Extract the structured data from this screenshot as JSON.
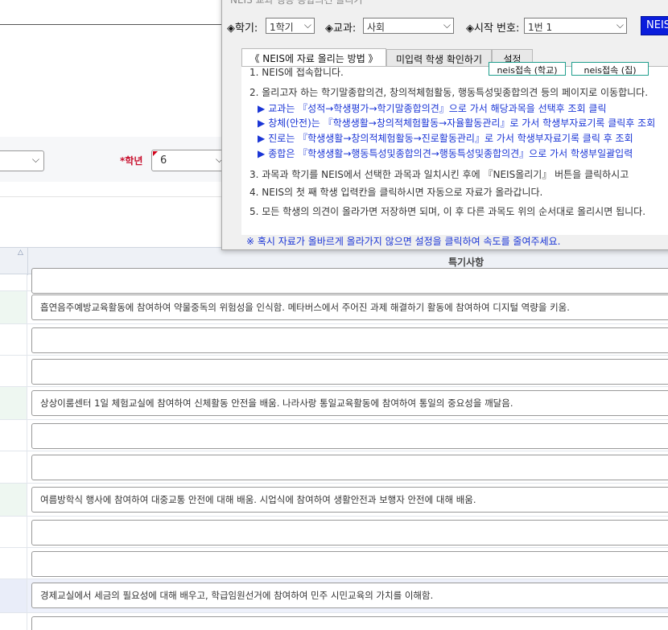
{
  "popup": {
    "title": "NEIS 교과 행동 종합의견 올리기",
    "semester_label": "◈학기:",
    "semester_value": "1학기",
    "subject_label": "◈교과:",
    "subject_value": "사회",
    "start_label": "◈시작 번호:",
    "start_value": "1번 1",
    "neis_button": "NEIS",
    "tabs": [
      {
        "label": "《 NEIS에 자료 올리는 방법 》"
      },
      {
        "label": "미입력 학생 확인하기"
      },
      {
        "label": "설정"
      }
    ],
    "step1": "1. NEIS에 접속합니다.",
    "connect_school": "neis접속 (학교)",
    "connect_home": "neis접속 (집)",
    "step2": "2. 올리고자 하는 학기말종합의견, 창의적체험활동, 행동특성및종합의견 등의 페이지로 이동합니다.",
    "sub_items": [
      "교과는 『성적→학생평가→학기말종합의견』으로 가서 해당과목을 선택후 조회 클릭",
      "창체(안전)는 『학생생활→창의적체험활동→자율활동관리』로 가서 학생부자료기록 클릭후 조회",
      "진로는 『학생생활→창의적체험활동→진로활동관리』로 가서 학생부자료기록 클릭 후 조회",
      "종합은 『학생생활→행동특성및종합의견→행동특성및종합의견』으로 가서 학생부일괄입력"
    ],
    "step3": "3. 과목과 학기를 NEIS에서 선택한 과목과 일치시킨 후에 『NEIS올리기』 버튼을 클릭하시고",
    "step4": "4. NEIS의 첫 째 학생 입력칸을 클릭하시면 자동으로 자료가 올라갑니다.",
    "step5": "5. 모든 학생의 의견이 올라가면 저장하면 되며, 이 후 다른 과목도 위의 순서대로 올리시면 됩니다.",
    "notice": "※ 혹시 자료가 올바르게 올라가지 않으면 설정을 클릭하여 속도를 줄여주세요."
  },
  "filters": {
    "grade_star": "*",
    "grade_label": "학년",
    "grade_value": "6"
  },
  "table": {
    "header": "특기사항",
    "rows": [
      {
        "text": ""
      },
      {
        "text": "흡연음주예방교육활동에 참여하여 약물중독의 위험성을 인식함. 메타버스에서 주어진 과제 해결하기 활동에 참여하여 디지털 역량을 키움."
      },
      {
        "text": ""
      },
      {
        "text": ""
      },
      {
        "text": "상상이룸센터 1일 체험교실에 참여하여 신체활동 안전을 배움. 나라사랑 통일교육활동에 참여하여 통일의 중요성을 깨달음."
      },
      {
        "text": ""
      },
      {
        "text": ""
      },
      {
        "text": "여름방학식 행사에 참여하여 대중교통 안전에 대해 배움. 시업식에 참여하여 생활안전과 보행자 안전에 대해 배움."
      },
      {
        "text": ""
      },
      {
        "text": ""
      },
      {
        "text": "경제교실에서 세금의 필요성에 대해 배우고, 학급임원선거에 참여하여 민주 시민교육의 가치를 이해함."
      },
      {
        "text": ""
      }
    ]
  },
  "colors": {
    "neis_button": "#0a1ddc",
    "link_blue": "#1a35d6",
    "required_red": "#c8102e"
  }
}
